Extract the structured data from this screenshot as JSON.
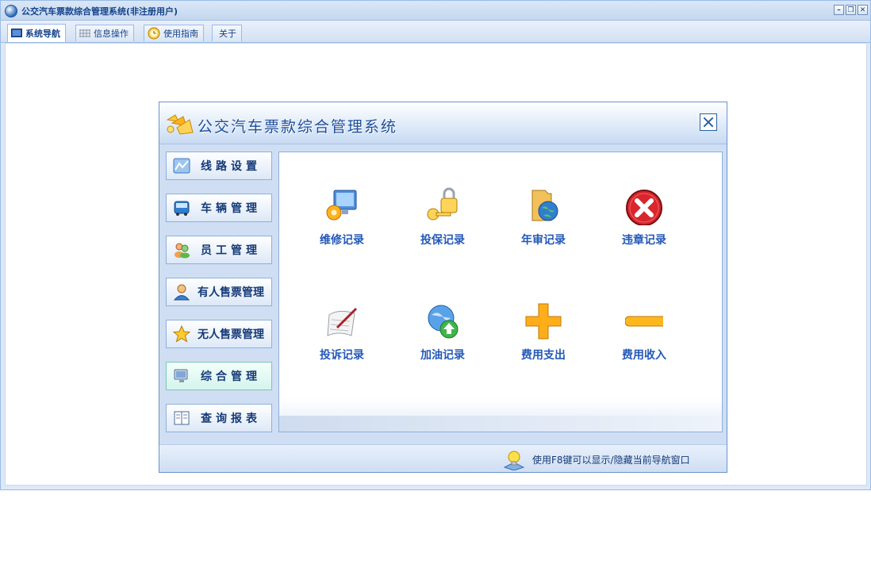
{
  "window": {
    "title": "公交汽车票款综合管理系统(非注册用户)",
    "buttons": {
      "minimize": "–",
      "restore": "❐",
      "close": "✕"
    }
  },
  "tabs": [
    {
      "label": "系统导航",
      "icon": "monitor-icon",
      "active": true
    },
    {
      "label": "信息操作",
      "icon": "grid-icon",
      "active": false
    },
    {
      "label": "使用指南",
      "icon": "clock-icon",
      "active": false
    },
    {
      "label": "关于",
      "icon": "",
      "active": false
    }
  ],
  "dialog": {
    "title": "公交汽车票款综合管理系统",
    "nav": [
      {
        "label": "线路设置",
        "icon": "route-map-icon",
        "active": false
      },
      {
        "label": "车辆管理",
        "icon": "bus-icon",
        "active": false
      },
      {
        "label": "员工管理",
        "icon": "people-icon",
        "active": false
      },
      {
        "label": "有人售票管理",
        "icon": "user-ticket-icon",
        "active": false
      },
      {
        "label": "无人售票管理",
        "icon": "star-icon",
        "active": false
      },
      {
        "label": "综合管理",
        "icon": "monitor-icon",
        "active": true
      },
      {
        "label": "查询报表",
        "icon": "report-icon",
        "active": false
      }
    ],
    "tiles": [
      {
        "label": "维修记录",
        "icon": "monitor-gear-icon"
      },
      {
        "label": "投保记录",
        "icon": "key-lock-icon"
      },
      {
        "label": "年审记录",
        "icon": "folder-globe-icon"
      },
      {
        "label": "违章记录",
        "icon": "red-x-icon"
      },
      {
        "label": "投诉记录",
        "icon": "pen-paper-icon"
      },
      {
        "label": "加油记录",
        "icon": "globe-upload-icon"
      },
      {
        "label": "费用支出",
        "icon": "plus-icon"
      },
      {
        "label": "费用收入",
        "icon": "minus-icon"
      }
    ],
    "hint": "使用F8键可以显示/隐藏当前导航窗口"
  },
  "colors": {
    "accent": "#15428b",
    "tile_label": "#2358b8",
    "border": "#99bbe8"
  }
}
